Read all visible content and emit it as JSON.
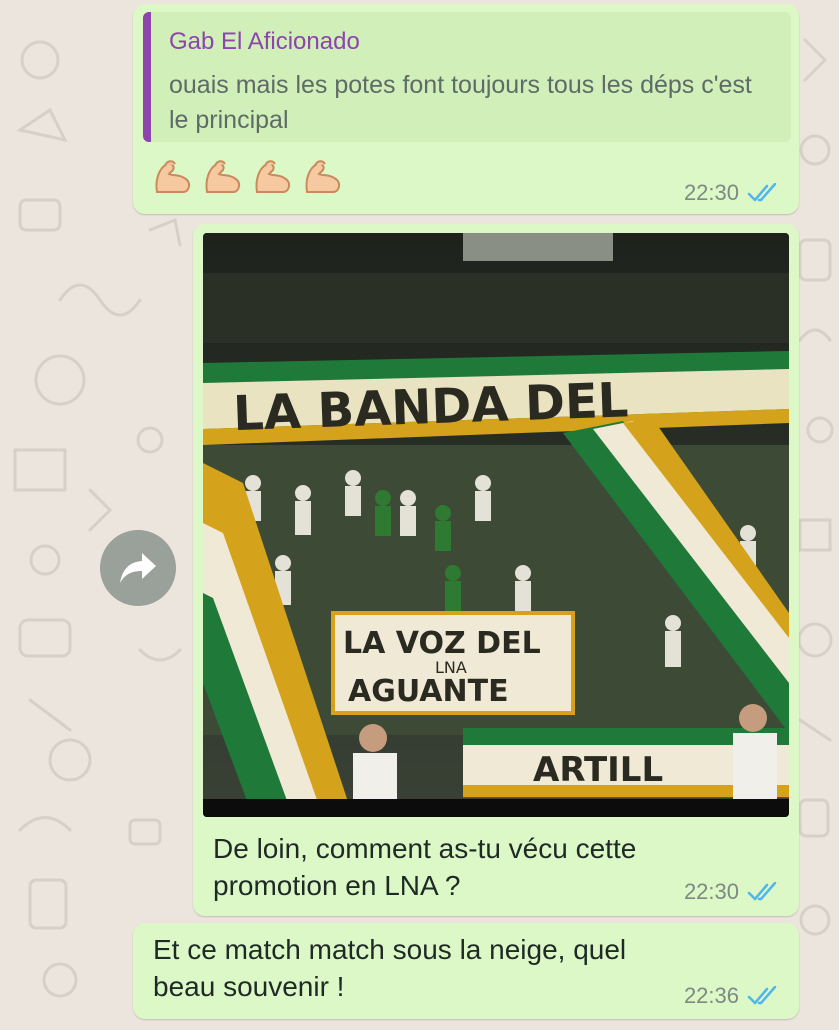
{
  "colors": {
    "bubble": "#dcf8c6",
    "quote_accent": "#8e44ad",
    "tick_read": "#4fb6ec",
    "chat_bg": "#ece5dd"
  },
  "messages": [
    {
      "quote": {
        "author": "Gab El Aficionado",
        "text": "ouais mais les potes font toujours tous les déps c'est le principal"
      },
      "emoji": [
        "flexed-biceps",
        "flexed-biceps",
        "flexed-biceps",
        "flexed-biceps"
      ],
      "time": "22:30",
      "status": "read"
    },
    {
      "image": {
        "banner_top": "LA BANDA DEL",
        "banner_mid_line1": "LA VOZ DEL",
        "banner_mid_small": "LNA",
        "banner_mid_line2": "AGUANTE",
        "banner_bottom": "ARTILL"
      },
      "caption": "De loin, comment as-tu vécu cette promotion en LNA ?",
      "time": "22:30",
      "status": "read"
    },
    {
      "text": "Et ce match match sous la neige, quel beau souvenir !",
      "time": "22:36",
      "status": "read"
    }
  ],
  "forward": {
    "icon": "forward-arrow-icon"
  }
}
